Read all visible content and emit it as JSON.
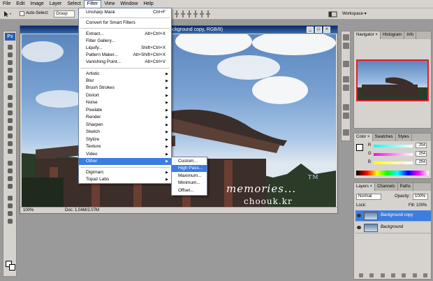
{
  "menubar": {
    "items": [
      "File",
      "Edit",
      "Image",
      "Layer",
      "Select",
      "Filter",
      "View",
      "Window",
      "Help"
    ],
    "active": "Filter"
  },
  "options": {
    "auto_select_label": "Auto-Select:",
    "auto_select_value": "Group",
    "workspace_label": "Workspace ▾"
  },
  "document": {
    "title": "ackground copy, RGB/8)",
    "zoom": "100%",
    "doc_info": "Doc: 1.04M/2.07M",
    "watermark_line1": "memories...",
    "watermark_line2": "choouk.kr",
    "watermark_tm": "TM"
  },
  "filter_menu": {
    "items": [
      {
        "label": "Unsharp Mask",
        "shortcut": "Ctrl+F",
        "arrow": false
      },
      {
        "label": "Convert for Smart Filters",
        "shortcut": "",
        "arrow": false
      },
      {
        "label": "Extract...",
        "shortcut": "Alt+Ctrl+X",
        "arrow": false
      },
      {
        "label": "Filter Gallery...",
        "shortcut": "",
        "arrow": false
      },
      {
        "label": "Liquify...",
        "shortcut": "Shift+Ctrl+X",
        "arrow": false
      },
      {
        "label": "Pattern Maker...",
        "shortcut": "Alt+Shift+Ctrl+X",
        "arrow": false
      },
      {
        "label": "Vanishing Point...",
        "shortcut": "Alt+Ctrl+V",
        "arrow": false
      },
      {
        "label": "Artistic",
        "shortcut": "",
        "arrow": true
      },
      {
        "label": "Blur",
        "shortcut": "",
        "arrow": true
      },
      {
        "label": "Brush Strokes",
        "shortcut": "",
        "arrow": true
      },
      {
        "label": "Distort",
        "shortcut": "",
        "arrow": true
      },
      {
        "label": "Noise",
        "shortcut": "",
        "arrow": true
      },
      {
        "label": "Pixelate",
        "shortcut": "",
        "arrow": true
      },
      {
        "label": "Render",
        "shortcut": "",
        "arrow": true
      },
      {
        "label": "Sharpen",
        "shortcut": "",
        "arrow": true
      },
      {
        "label": "Sketch",
        "shortcut": "",
        "arrow": true
      },
      {
        "label": "Stylize",
        "shortcut": "",
        "arrow": true
      },
      {
        "label": "Texture",
        "shortcut": "",
        "arrow": true
      },
      {
        "label": "Video",
        "shortcut": "",
        "arrow": true
      },
      {
        "label": "Other",
        "shortcut": "",
        "arrow": true,
        "highlighted": true
      },
      {
        "label": "Digimarc",
        "shortcut": "",
        "arrow": true
      },
      {
        "label": "Topaz Labs",
        "shortcut": "",
        "arrow": true
      }
    ]
  },
  "other_submenu": {
    "items": [
      "Custom...",
      "High Pass...",
      "Maximum...",
      "Minimum...",
      "Offset..."
    ],
    "highlighted": "High Pass..."
  },
  "navigator_panel": {
    "tabs": [
      "Navigator ×",
      "Histogram",
      "Info"
    ]
  },
  "color_panel": {
    "tabs": [
      "Color ×",
      "Swatches",
      "Styles"
    ],
    "channels": [
      {
        "label": "R",
        "value": "254"
      },
      {
        "label": "G",
        "value": "254"
      },
      {
        "label": "B",
        "value": "254"
      }
    ]
  },
  "layers_panel": {
    "tabs": [
      "Layers ×",
      "Channels",
      "Paths"
    ],
    "blend_mode": "Normal",
    "opacity_label": "Opacity:",
    "opacity_value": "100%",
    "lock_label": "Lock:",
    "fill_label": "Fill:",
    "fill_value": "100%",
    "layers": [
      {
        "name": "Background copy",
        "selected": true
      },
      {
        "name": "Background",
        "selected": false
      }
    ]
  },
  "colors": {
    "menu_highlight": "#3d7de0",
    "nav_frame": "#e0202a",
    "app_gray": "#d6d3ce"
  }
}
